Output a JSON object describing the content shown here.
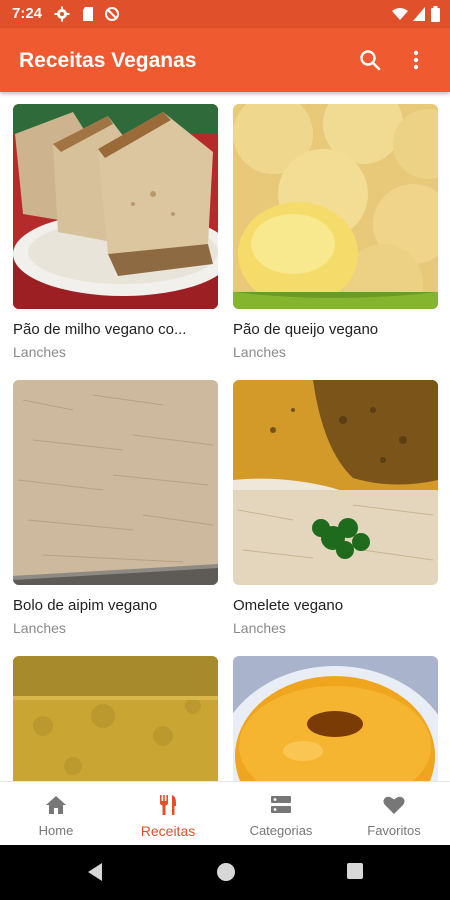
{
  "status_bar": {
    "time": "7:24"
  },
  "app_bar": {
    "title": "Receitas Veganas",
    "search_icon": "search-icon",
    "menu_icon": "more-vert-icon"
  },
  "recipes": [
    {
      "name": "Pão de milho vegano co...",
      "category": "Lanches"
    },
    {
      "name": "Pão de queijo vegano",
      "category": "Lanches"
    },
    {
      "name": "Bolo de aipim vegano",
      "category": "Lanches"
    },
    {
      "name": "Omelete vegano",
      "category": "Lanches"
    },
    {
      "name": "",
      "category": ""
    },
    {
      "name": "",
      "category": ""
    }
  ],
  "bottom_nav": {
    "items": [
      {
        "label": "Home",
        "icon": "home-icon",
        "active": false
      },
      {
        "label": "Receitas",
        "icon": "fork-knife-icon",
        "active": true
      },
      {
        "label": "Categorias",
        "icon": "categories-icon",
        "active": false
      },
      {
        "label": "Favoritos",
        "icon": "heart-icon",
        "active": false
      }
    ]
  },
  "colors": {
    "primary": "#f05a31",
    "primary_dark": "#e0502b",
    "active_nav": "#e0502b"
  }
}
